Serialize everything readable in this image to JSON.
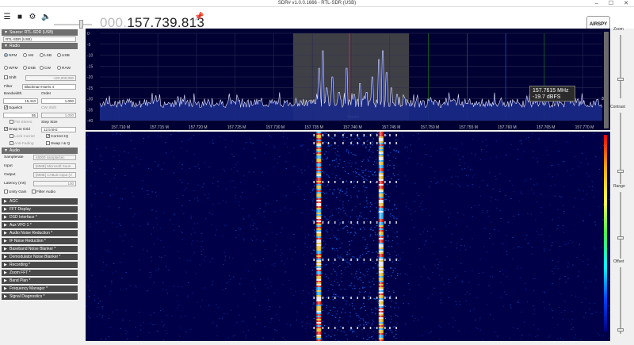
{
  "window": {
    "title": "SDR# v1.0.0.1666 - RTL-SDR (USB)",
    "minimize": "–",
    "maximize": "☐",
    "close": "✕"
  },
  "toolbar": {
    "freq_dim": "000.",
    "freq_main": "157.739.813",
    "logo": "AIRSPY"
  },
  "source": {
    "header": "Source: RTL-SDR (USB)",
    "device": "RTL-SDR (USB)"
  },
  "radio": {
    "header": "Radio",
    "modes": [
      "NFM",
      "AM",
      "LSB",
      "USB",
      "WFM",
      "DSB",
      "CW",
      "RAW"
    ],
    "selected_mode": "NFM",
    "shift_label": "Shift",
    "shift_value": "-120,000,000",
    "filter_label": "Filter",
    "filter_value": "Blackman-Harris 4",
    "bandwidth_label": "Bandwidth",
    "bandwidth_value": "15,410",
    "order_label": "Order",
    "order_value": "1,000",
    "squelch_label": "Squelch",
    "squelch_value": "55",
    "cw_shift_label": "CW Shift",
    "cw_shift_value": "1,000",
    "fm_stereo_label": "FM Stereo",
    "step_size_label": "Step Size",
    "snap_label": "Snap to Grid",
    "snap_value": "12.5 kHz",
    "lock_carrier_label": "Lock Carrier",
    "correct_iq_label": "Correct IQ",
    "anti_fading_label": "Anti-Fading",
    "swap_iq_label": "Swap I & Q"
  },
  "audio": {
    "header": "Audio",
    "samplerate_label": "Samplerate",
    "samplerate_value": "48000 sample/sec",
    "input_label": "Input",
    "input_value": "[MME] Microsoft Soun",
    "output_label": "Output",
    "output_value": "[MME] CABLE Input (V",
    "latency_label": "Latency (ms)",
    "latency_value": "100",
    "unity_gain_label": "Unity Gain",
    "filter_audio_label": "Filter Audio"
  },
  "plugins": [
    "AGC",
    "FFT Display",
    "DSD Interface *",
    "Aux VFO 1 *",
    "Audio Noise Reduction *",
    "IF Noise Reduction *",
    "Baseband Noise Blanker *",
    "Demodulator Noise Blanker *",
    "Recording *",
    "Zoom FFT *",
    "Band Plan *",
    "Frequency Manager *",
    "Signal Diagnostics *"
  ],
  "right_panel": {
    "zoom": "Zoom",
    "contrast": "Contrast",
    "range": "Range",
    "offset": "Offset"
  },
  "spectrum": {
    "y_ticks": [
      "0",
      "-5",
      "-10",
      "-15",
      "-20",
      "-25",
      "-30",
      "-35",
      "-40"
    ],
    "x_ticks": [
      "157.710 M",
      "157.715 M",
      "157.720 M",
      "157.725 M",
      "157.730 M",
      "157.735 M",
      "157.740 M",
      "157.745 M",
      "157.750 M",
      "157.755 M",
      "157.760 M",
      "157.765 M",
      "157.770 M"
    ],
    "band_label": "Marine",
    "tooltip_freq": "157.7615 MHz",
    "tooltip_level": "-19.7 dBFS",
    "scale_value": "38"
  },
  "colors": {
    "spectrum_bg": "#000033",
    "waterfall_bg": "#000048",
    "vfo_line": "#ff2020",
    "band_fill": "#4a4a4a"
  }
}
